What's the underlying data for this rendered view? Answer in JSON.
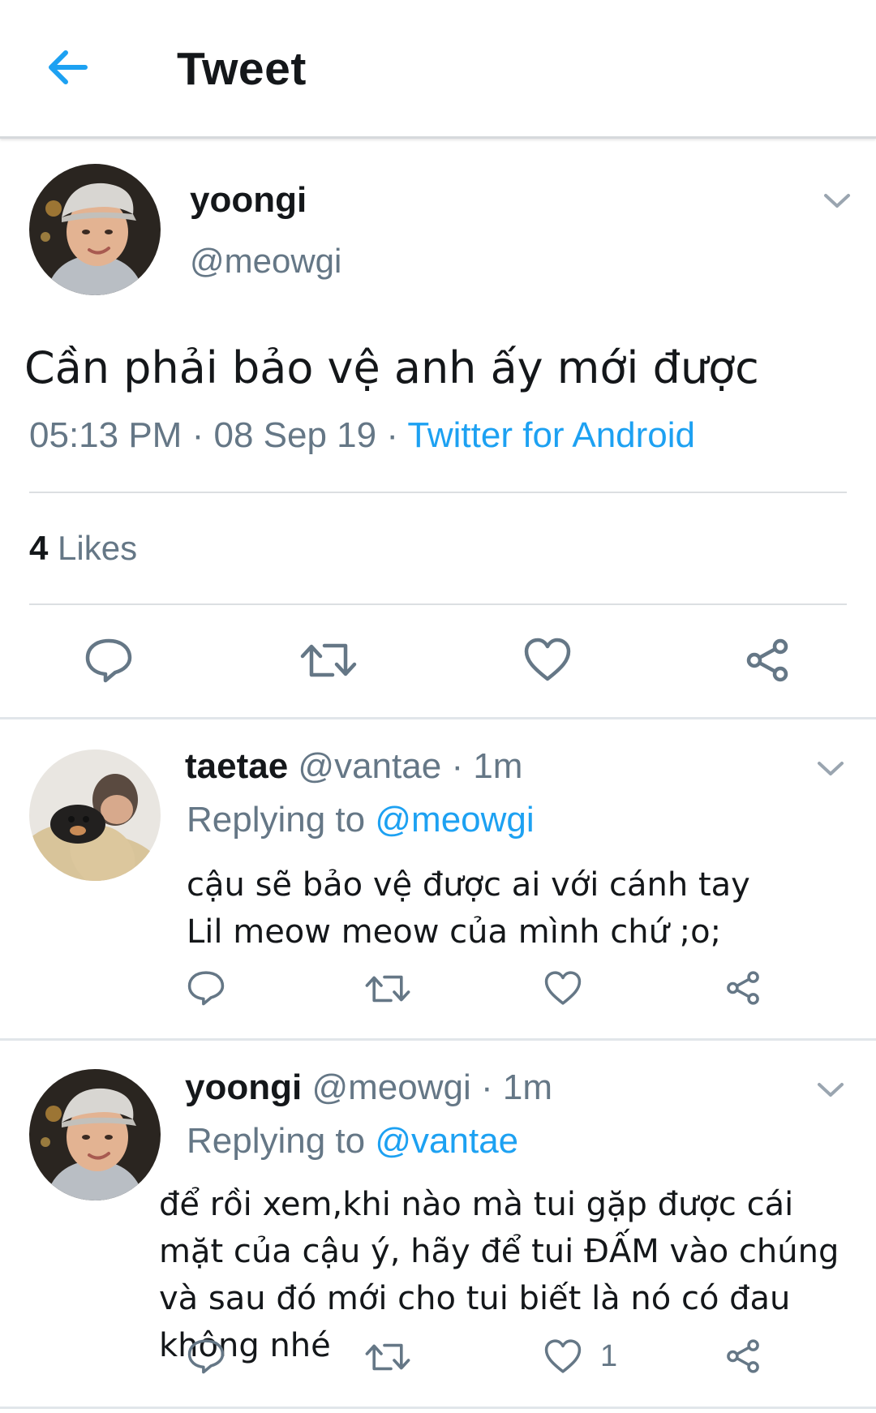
{
  "header": {
    "title": "Tweet",
    "back_icon": "arrow-left-icon"
  },
  "colors": {
    "accent": "#1da1f2",
    "muted": "#657786",
    "text": "#14171a",
    "divider": "#e1e6ea"
  },
  "main_tweet": {
    "display_name": "yoongi",
    "handle": "@meowgi",
    "text": "Cần phải bảo vệ anh ấy mới được",
    "time": "05:13 PM",
    "date": "08 Sep 19",
    "source": "Twitter for Android",
    "separator": "·",
    "likes_count": "4",
    "likes_label": "Likes"
  },
  "replies": [
    {
      "display_name": "taetae",
      "handle": "@vantae",
      "time": "1m",
      "separator": "·",
      "replying_label": "Replying to",
      "replying_to": "@meowgi",
      "text": "cậu sẽ bảo vệ được ai với cánh tay Lil meow meow của mình chứ ;o;",
      "like_count": ""
    },
    {
      "display_name": "yoongi",
      "handle": "@meowgi",
      "time": "1m",
      "separator": "·",
      "replying_label": "Replying to",
      "replying_to": "@vantae",
      "text": "để rồi xem,khi nào mà tui gặp được cái mặt của cậu ý, hãy để tui ĐẤM vào chúng và sau đó mới cho tui biết là nó có đau không nhé",
      "like_count": "1"
    }
  ],
  "icons": {
    "reply": "reply-bubble-icon",
    "retweet": "retweet-icon",
    "like": "heart-icon",
    "share": "share-icon",
    "more": "chevron-down-icon"
  }
}
